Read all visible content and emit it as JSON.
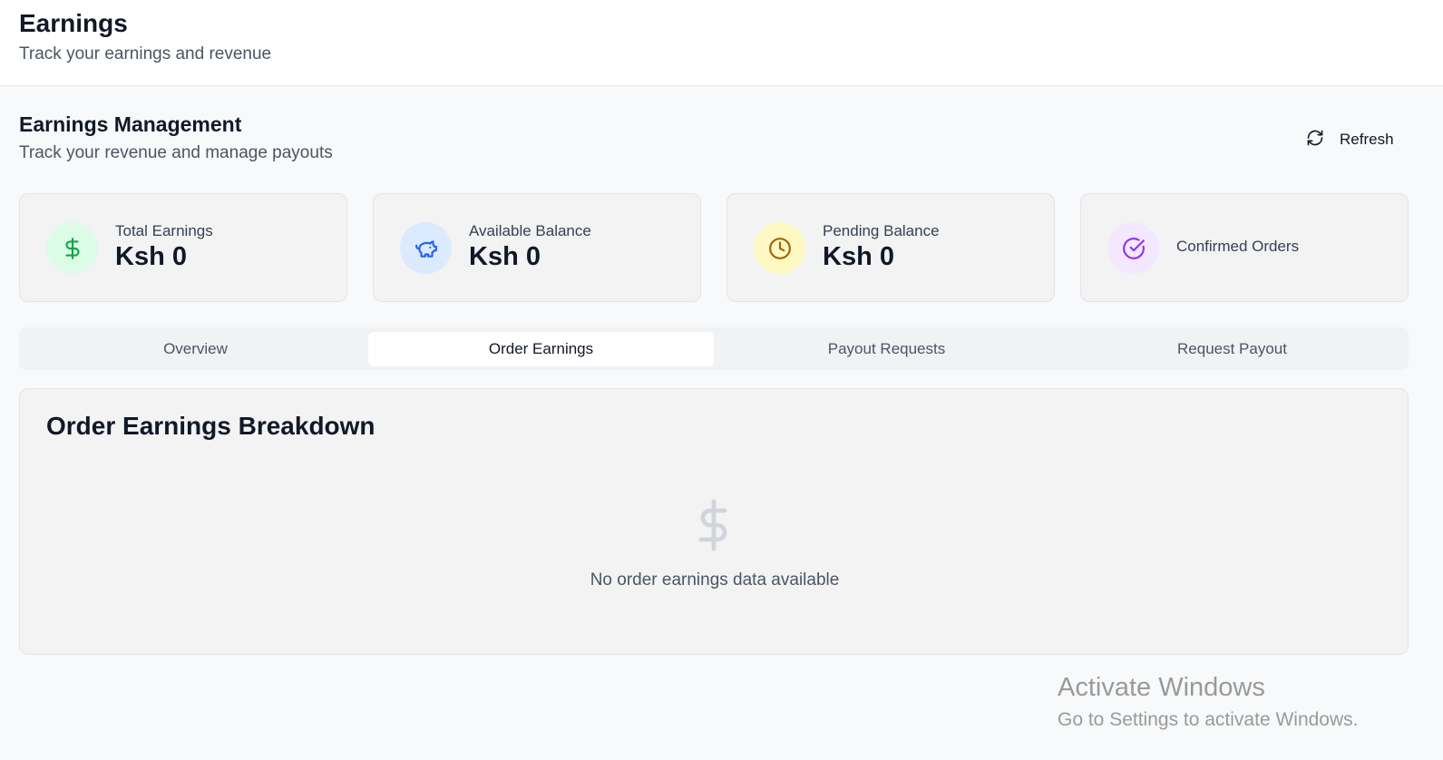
{
  "header": {
    "title": "Earnings",
    "subtitle": "Track your earnings and revenue"
  },
  "section": {
    "title": "Earnings Management",
    "subtitle": "Track your revenue and manage payouts",
    "refresh_label": "Refresh"
  },
  "stats": [
    {
      "label": "Total Earnings",
      "value": "Ksh 0",
      "icon": "dollar-icon",
      "icon_color": "#16a34a",
      "icon_bg": "#dcfce7"
    },
    {
      "label": "Available Balance",
      "value": "Ksh 0",
      "icon": "piggy-bank-icon",
      "icon_color": "#2563eb",
      "icon_bg": "#dbeafe"
    },
    {
      "label": "Pending Balance",
      "value": "Ksh 0",
      "icon": "clock-icon",
      "icon_color": "#a16207",
      "icon_bg": "#fef9c3"
    },
    {
      "label": "Confirmed Orders",
      "value": "",
      "icon": "check-circle-icon",
      "icon_color": "#9333ea",
      "icon_bg": "#f3e8ff"
    }
  ],
  "tabs": [
    {
      "label": "Overview",
      "active": false
    },
    {
      "label": "Order Earnings",
      "active": true
    },
    {
      "label": "Payout Requests",
      "active": false
    },
    {
      "label": "Request Payout",
      "active": false
    }
  ],
  "panel": {
    "title": "Order Earnings Breakdown",
    "empty_icon": "dollar-icon",
    "empty_text": "No order earnings data available"
  },
  "watermark": {
    "title": "Activate Windows",
    "subtitle": "Go to Settings to activate Windows."
  }
}
